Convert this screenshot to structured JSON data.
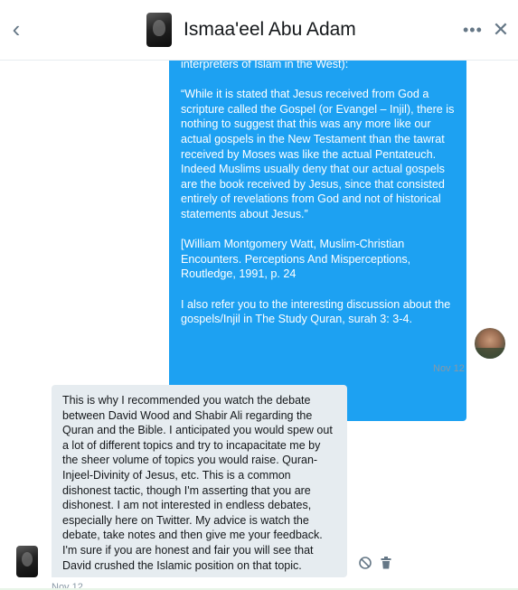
{
  "header": {
    "back_icon": "chevron-left-icon",
    "title": "Ismaa'eel Abu Adam",
    "more_icon": "more-dots-icon",
    "more_label": "•••",
    "close_icon": "close-icon",
    "close_label": "✕",
    "back_label": "‹"
  },
  "messages": {
    "sent": {
      "paragraphs": [
        "interpreters of Islam in the West):",
        "“While it is stated that Jesus received from God a scripture called the Gospel (or Evangel – Injil), there is nothing to suggest that this was any more like our actual gospels in the New Testament than the tawrat received by Moses was like the actual Pentateuch. Indeed Muslims usually deny that our actual gospels are the book received by Jesus, since that consisted entirely of revelations from God and not of historical statements about Jesus.”",
        "[William Montgomery Watt, Muslim-Christian Encounters. Perceptions And Misperceptions, Routledge, 1991, p. 24",
        "I also refer you to the interesting discussion about the gospels/Injil in The Study Quran, surah 3: 3-4."
      ],
      "timestamp": "Nov 12"
    },
    "received": {
      "text": "This is why I recommended you watch the debate between David Wood and Shabir Ali regarding the Quran and the Bible.  I anticipated you would spew out a lot of different topics and try to incapacitate me by the sheer volume of topics you would raise. Quran-Injeel-Divinity of Jesus, etc. This is a common dishonest tactic, though I'm asserting that you are dishonest. I am not interested in endless debates, especially here on Twitter. My advice is watch the debate, take notes and then give me your feedback. I'm sure if you are honest and fair you will see that David crushed the Islamic position on that topic.",
      "timestamp": "Nov 12"
    }
  },
  "colors": {
    "accent": "#1da1f2",
    "received_bubble": "#e6ecf0",
    "muted_text": "#8899a6",
    "icon_gray": "#657786"
  }
}
